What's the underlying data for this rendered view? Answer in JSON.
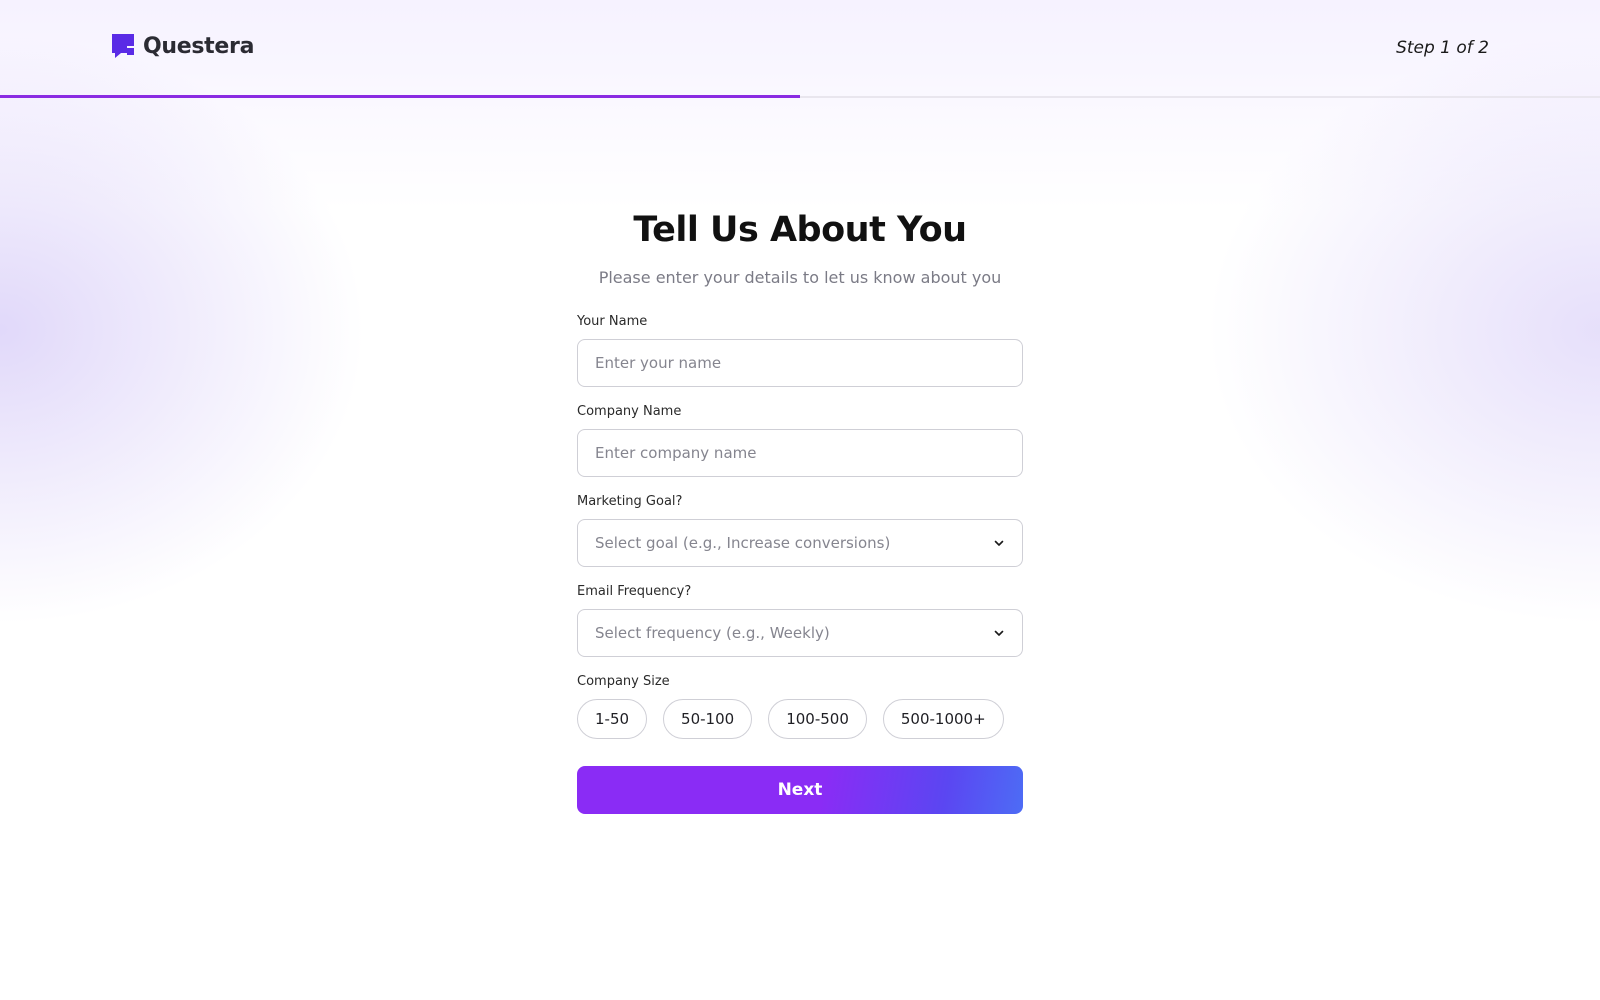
{
  "brand": {
    "name": "Questera",
    "logo_icon": "questera-logo-icon",
    "accent_color": "#8a2be2"
  },
  "header": {
    "step_text": "Step 1 of 2",
    "progress": 0.5
  },
  "form": {
    "title": "Tell Us About You",
    "subtitle": "Please enter your details to let us know about you",
    "name": {
      "label": "Your Name",
      "placeholder": "Enter your name",
      "value": ""
    },
    "company": {
      "label": "Company Name",
      "placeholder": "Enter company name",
      "value": ""
    },
    "goal": {
      "label": "Marketing Goal?",
      "placeholder": "Select goal (e.g., Increase conversions)",
      "icon": "chevron-down-icon"
    },
    "frequency": {
      "label": "Email Frequency?",
      "placeholder": "Select frequency (e.g., Weekly)",
      "icon": "chevron-down-icon"
    },
    "company_size": {
      "label": "Company Size",
      "options": [
        "1-50",
        "50-100",
        "100-500",
        "500-1000+"
      ]
    },
    "next_label": "Next",
    "next_gradient": [
      "#8a2cf5",
      "#4d6cf5"
    ]
  }
}
